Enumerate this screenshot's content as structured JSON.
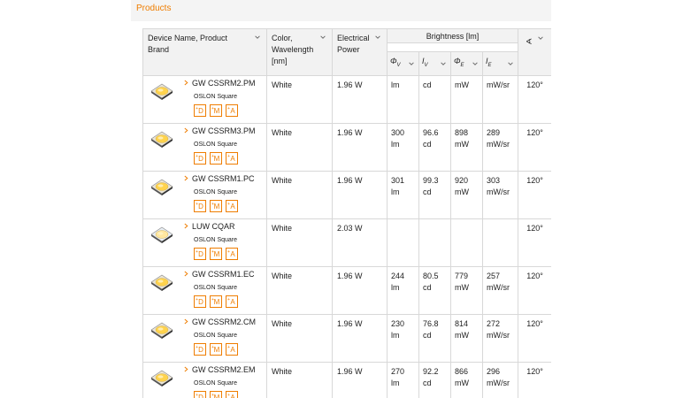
{
  "header": {
    "title": "Products"
  },
  "columns": {
    "device": "Device Name, Product Brand",
    "color": "Color, Wavelength [nm]",
    "power": "Electrical Power",
    "brightness": "Brightness [lm]",
    "flux_v": "Φ",
    "flux_v_sub": "V",
    "intensity_v": "I",
    "intensity_v_sub": "V",
    "flux_e": "Φ",
    "flux_e_sub": "E",
    "intensity_e": "I",
    "intensity_e_sub": "E",
    "angle_icon": "∢"
  },
  "rows": [
    {
      "name": "GW CSSRM2.PM",
      "brand": "OSLON Square",
      "color": "White",
      "power": "1.96 W",
      "flux_v": "",
      "flux_v_unit": "lm",
      "iv": "",
      "iv_unit": "cd",
      "flux_e": "",
      "flux_e_unit": "mW",
      "ie": "",
      "ie_unit": "mW/sr",
      "angle": "120°"
    },
    {
      "name": "GW CSSRM3.PM",
      "brand": "OSLON Square",
      "color": "White",
      "power": "1.96 W",
      "flux_v": "300",
      "flux_v_unit": "lm",
      "iv": "96.6",
      "iv_unit": "cd",
      "flux_e": "898",
      "flux_e_unit": "mW",
      "ie": "289",
      "ie_unit": "mW/sr",
      "angle": "120°"
    },
    {
      "name": "GW CSSRM1.PC",
      "brand": "OSLON Square",
      "color": "White",
      "power": "1.96 W",
      "flux_v": "301",
      "flux_v_unit": "lm",
      "iv": "99.3",
      "iv_unit": "cd",
      "flux_e": "920",
      "flux_e_unit": "mW",
      "ie": "303",
      "ie_unit": "mW/sr",
      "angle": "120°"
    },
    {
      "name": "LUW CQAR",
      "brand": "OSLON Square",
      "color": "White",
      "power": "2.03 W",
      "flux_v": "",
      "flux_v_unit": "",
      "iv": "",
      "iv_unit": "",
      "flux_e": "",
      "flux_e_unit": "",
      "ie": "",
      "ie_unit": "",
      "angle": "120°"
    },
    {
      "name": "GW CSSRM1.EC",
      "brand": "OSLON Square",
      "color": "White",
      "power": "1.96 W",
      "flux_v": "244",
      "flux_v_unit": "lm",
      "iv": "80.5",
      "iv_unit": "cd",
      "flux_e": "779",
      "flux_e_unit": "mW",
      "ie": "257",
      "ie_unit": "mW/sr",
      "angle": "120°"
    },
    {
      "name": "GW CSSRM2.CM",
      "brand": "OSLON Square",
      "color": "White",
      "power": "1.96 W",
      "flux_v": "230",
      "flux_v_unit": "lm",
      "iv": "76.8",
      "iv_unit": "cd",
      "flux_e": "814",
      "flux_e_unit": "mW",
      "ie": "272",
      "ie_unit": "mW/sr",
      "angle": "120°"
    },
    {
      "name": "GW CSSRM2.EM",
      "brand": "OSLON Square",
      "color": "White",
      "power": "1.96 W",
      "flux_v": "270",
      "flux_v_unit": "lm",
      "iv": "92.2",
      "iv_unit": "cd",
      "flux_e": "866",
      "flux_e_unit": "mW",
      "ie": "296",
      "ie_unit": "mW/sr",
      "angle": "120°"
    }
  ],
  "badges": [
    {
      "sup": "+",
      "letter": "D"
    },
    {
      "sup": "+",
      "letter": "M"
    },
    {
      "sup": "+",
      "letter": "A"
    }
  ],
  "accent_color": "#ef7d00"
}
